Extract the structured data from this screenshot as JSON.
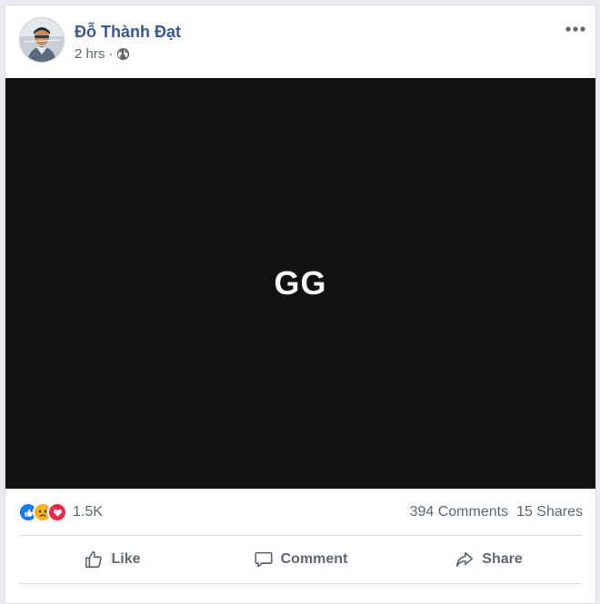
{
  "post": {
    "author": "Đỗ Thành Đạt",
    "timestamp": "2 hrs",
    "separator": "·",
    "privacy_icon": "globe-icon",
    "more_icon": "more-options-icon",
    "media_text": "GG",
    "media_background": "#111111"
  },
  "stats": {
    "reaction_icons": [
      "like-reaction-icon",
      "sad-reaction-icon",
      "love-reaction-icon"
    ],
    "reaction_count": "1.5K",
    "comments": "394 Comments",
    "shares": "15 Shares"
  },
  "actions": {
    "like_label": "Like",
    "comment_label": "Comment",
    "share_label": "Share"
  },
  "colors": {
    "author_link": "#385898",
    "secondary_text": "#606770",
    "like_blue": "#1877f2",
    "love_red": "#f02849",
    "sad_yellow": "#f7b125"
  }
}
